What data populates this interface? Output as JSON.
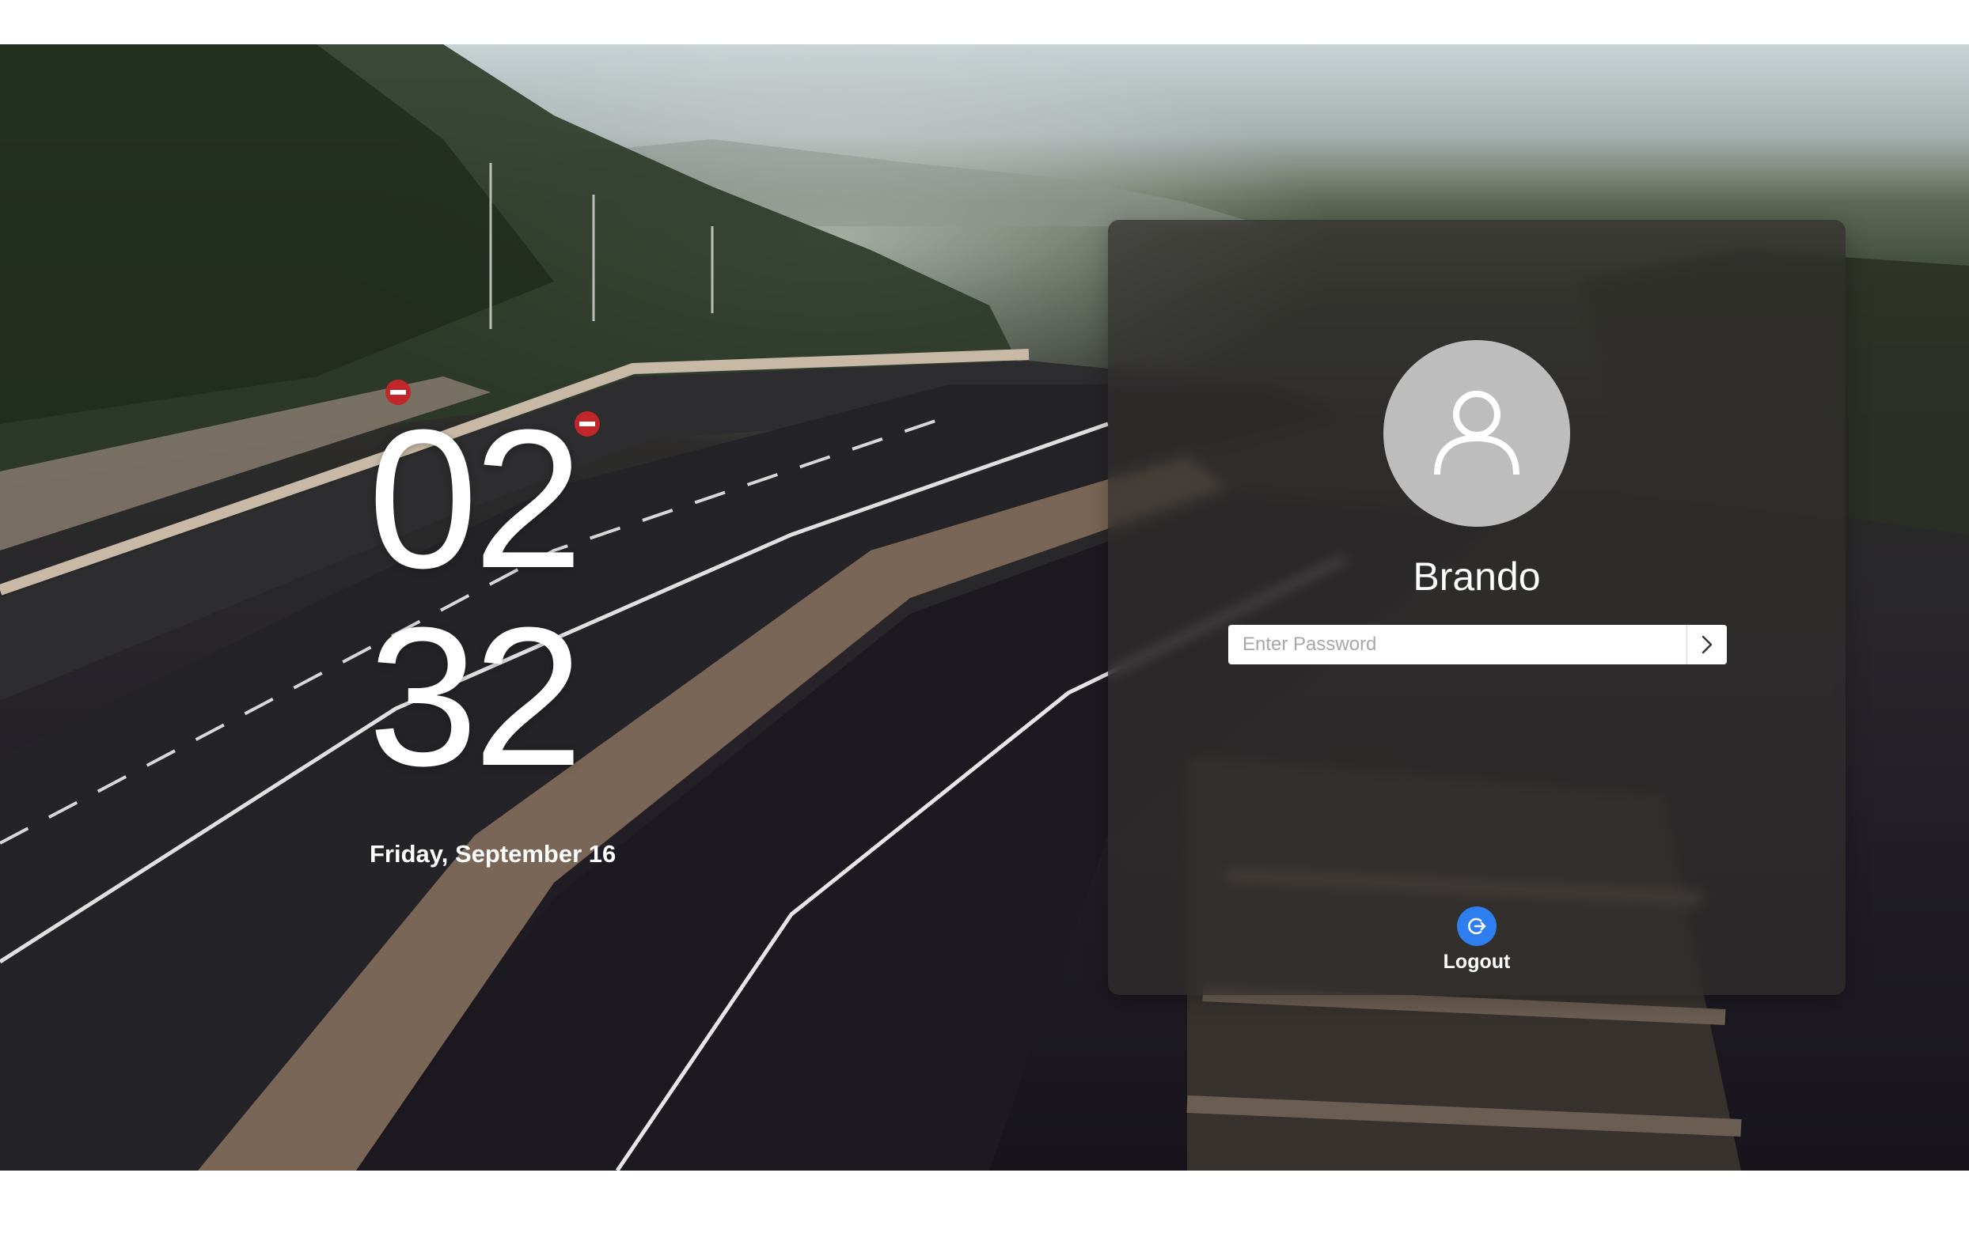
{
  "clock": {
    "hours": "02",
    "minutes": "32",
    "date": "Friday, September 16"
  },
  "login": {
    "username": "Brando",
    "password_placeholder": "Enter Password",
    "submit_icon": "chevron-right-icon",
    "logout_label": "Logout",
    "logout_icon": "logout-icon",
    "avatar_icon": "user-icon"
  },
  "colors": {
    "accent": "#2f7ef0",
    "panel": "#302e2c",
    "avatar_bg": "#bdbdbd"
  }
}
